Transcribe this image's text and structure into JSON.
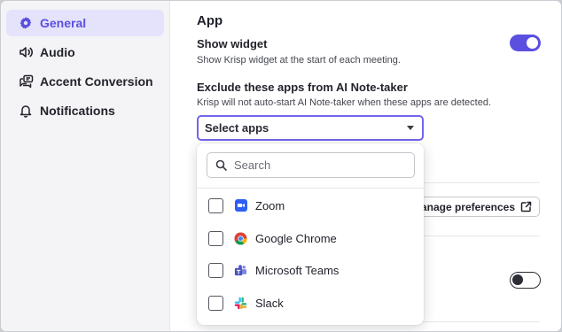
{
  "sidebar": {
    "items": [
      {
        "label": "General",
        "icon": "gear-icon",
        "active": true
      },
      {
        "label": "Audio",
        "icon": "speaker-icon",
        "active": false
      },
      {
        "label": "Accent Conversion",
        "icon": "accent-conversion-icon",
        "active": false
      },
      {
        "label": "Notifications",
        "icon": "bell-icon",
        "active": false
      }
    ]
  },
  "main": {
    "section_title": "App",
    "show_widget": {
      "title": "Show widget",
      "description": "Show Krisp widget at the start of each meeting.",
      "enabled": true
    },
    "exclude_apps": {
      "title": "Exclude these apps from AI Note-taker",
      "description": "Krisp will not auto-start AI Note-taker when these apps are detected.",
      "select_value": "Select apps"
    },
    "manage_button_label": "Manage preferences",
    "lower_toggle_enabled": false
  },
  "dropdown": {
    "search_placeholder": "Search",
    "options": [
      {
        "label": "Zoom",
        "icon": "zoom-icon",
        "checked": false
      },
      {
        "label": "Google Chrome",
        "icon": "chrome-icon",
        "checked": false
      },
      {
        "label": "Microsoft Teams",
        "icon": "teams-icon",
        "checked": false
      },
      {
        "label": "Slack",
        "icon": "slack-icon",
        "checked": false
      }
    ]
  },
  "colors": {
    "accent": "#5b4fe0",
    "active_nav_bg": "#e5e3fb",
    "sidebar_bg": "#f4f4f6"
  }
}
